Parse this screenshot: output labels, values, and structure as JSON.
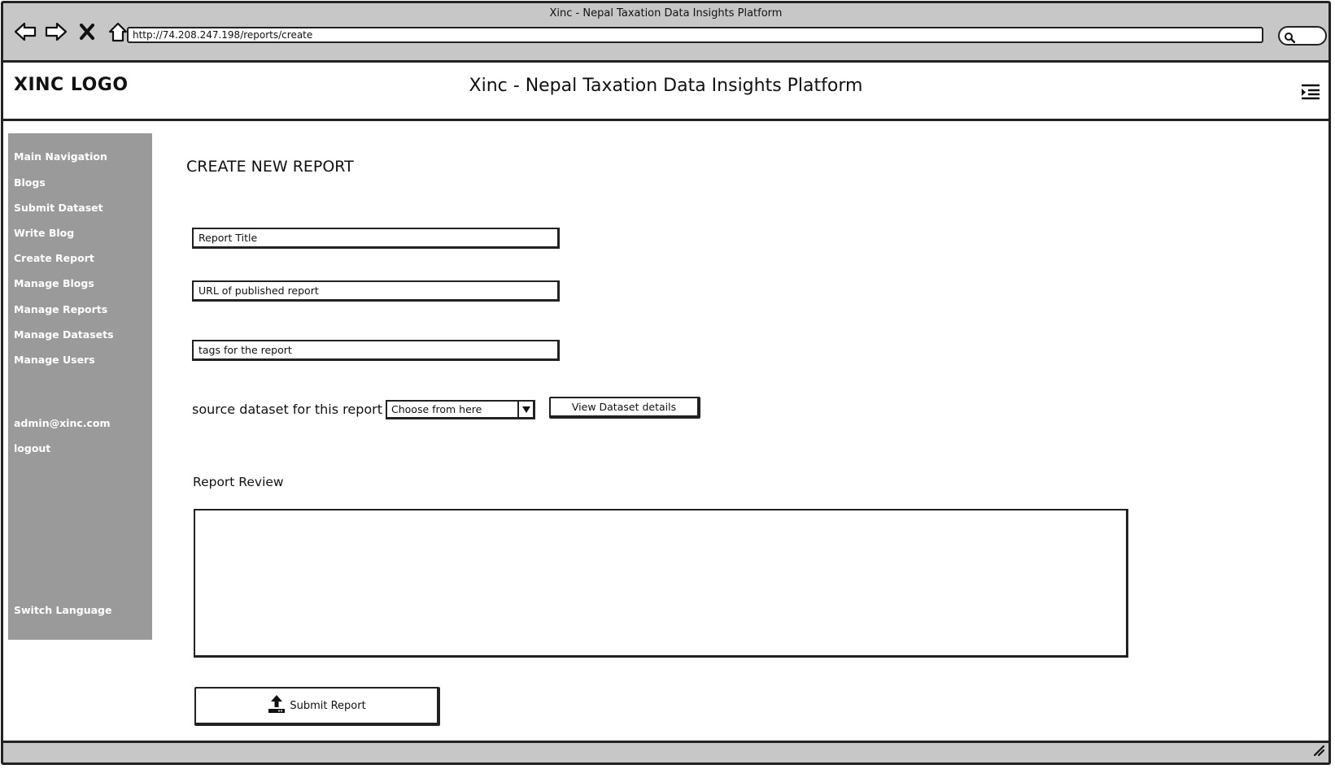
{
  "browser": {
    "window_title": "Xinc - Nepal Taxation Data Insights Platform",
    "url": "http://74.208.247.198/reports/create",
    "icons": [
      "back-arrow-icon",
      "forward-arrow-icon",
      "close-icon",
      "home-icon",
      "search-icon"
    ]
  },
  "header": {
    "logo": "XINC LOGO",
    "title": "Xinc - Nepal Taxation Data Insights Platform",
    "menu_icon": "menu-icon"
  },
  "sidebar": {
    "items": [
      {
        "label": "Main Navigation"
      },
      {
        "label": "Blogs"
      },
      {
        "label": "Submit Dataset"
      },
      {
        "label": "Write Blog"
      },
      {
        "label": "Create Report"
      },
      {
        "label": "Manage Blogs"
      },
      {
        "label": "Manage Reports"
      },
      {
        "label": "Manage Datasets"
      },
      {
        "label": "Manage Users"
      }
    ],
    "user_email": "admin@xinc.com",
    "logout": "logout",
    "switch_language": "Switch Language"
  },
  "main": {
    "heading": "CREATE NEW REPORT",
    "fields": {
      "report_title": {
        "placeholder": "Report Title",
        "value": ""
      },
      "report_url": {
        "placeholder": "URL of published report",
        "value": ""
      },
      "tags": {
        "placeholder": "tags for the report",
        "value": ""
      }
    },
    "source_label": "source dataset for this report",
    "source_select": {
      "selected": "Choose from here"
    },
    "view_dataset_button": "View Dataset details",
    "review_label": "Report Review",
    "review_value": "",
    "submit_button": "Submit Report"
  },
  "colors": {
    "chrome_bg": "#c7c7c7",
    "sidebar_bg": "#9a9a9a",
    "sidebar_text": "#ffffff",
    "border": "#222222"
  }
}
